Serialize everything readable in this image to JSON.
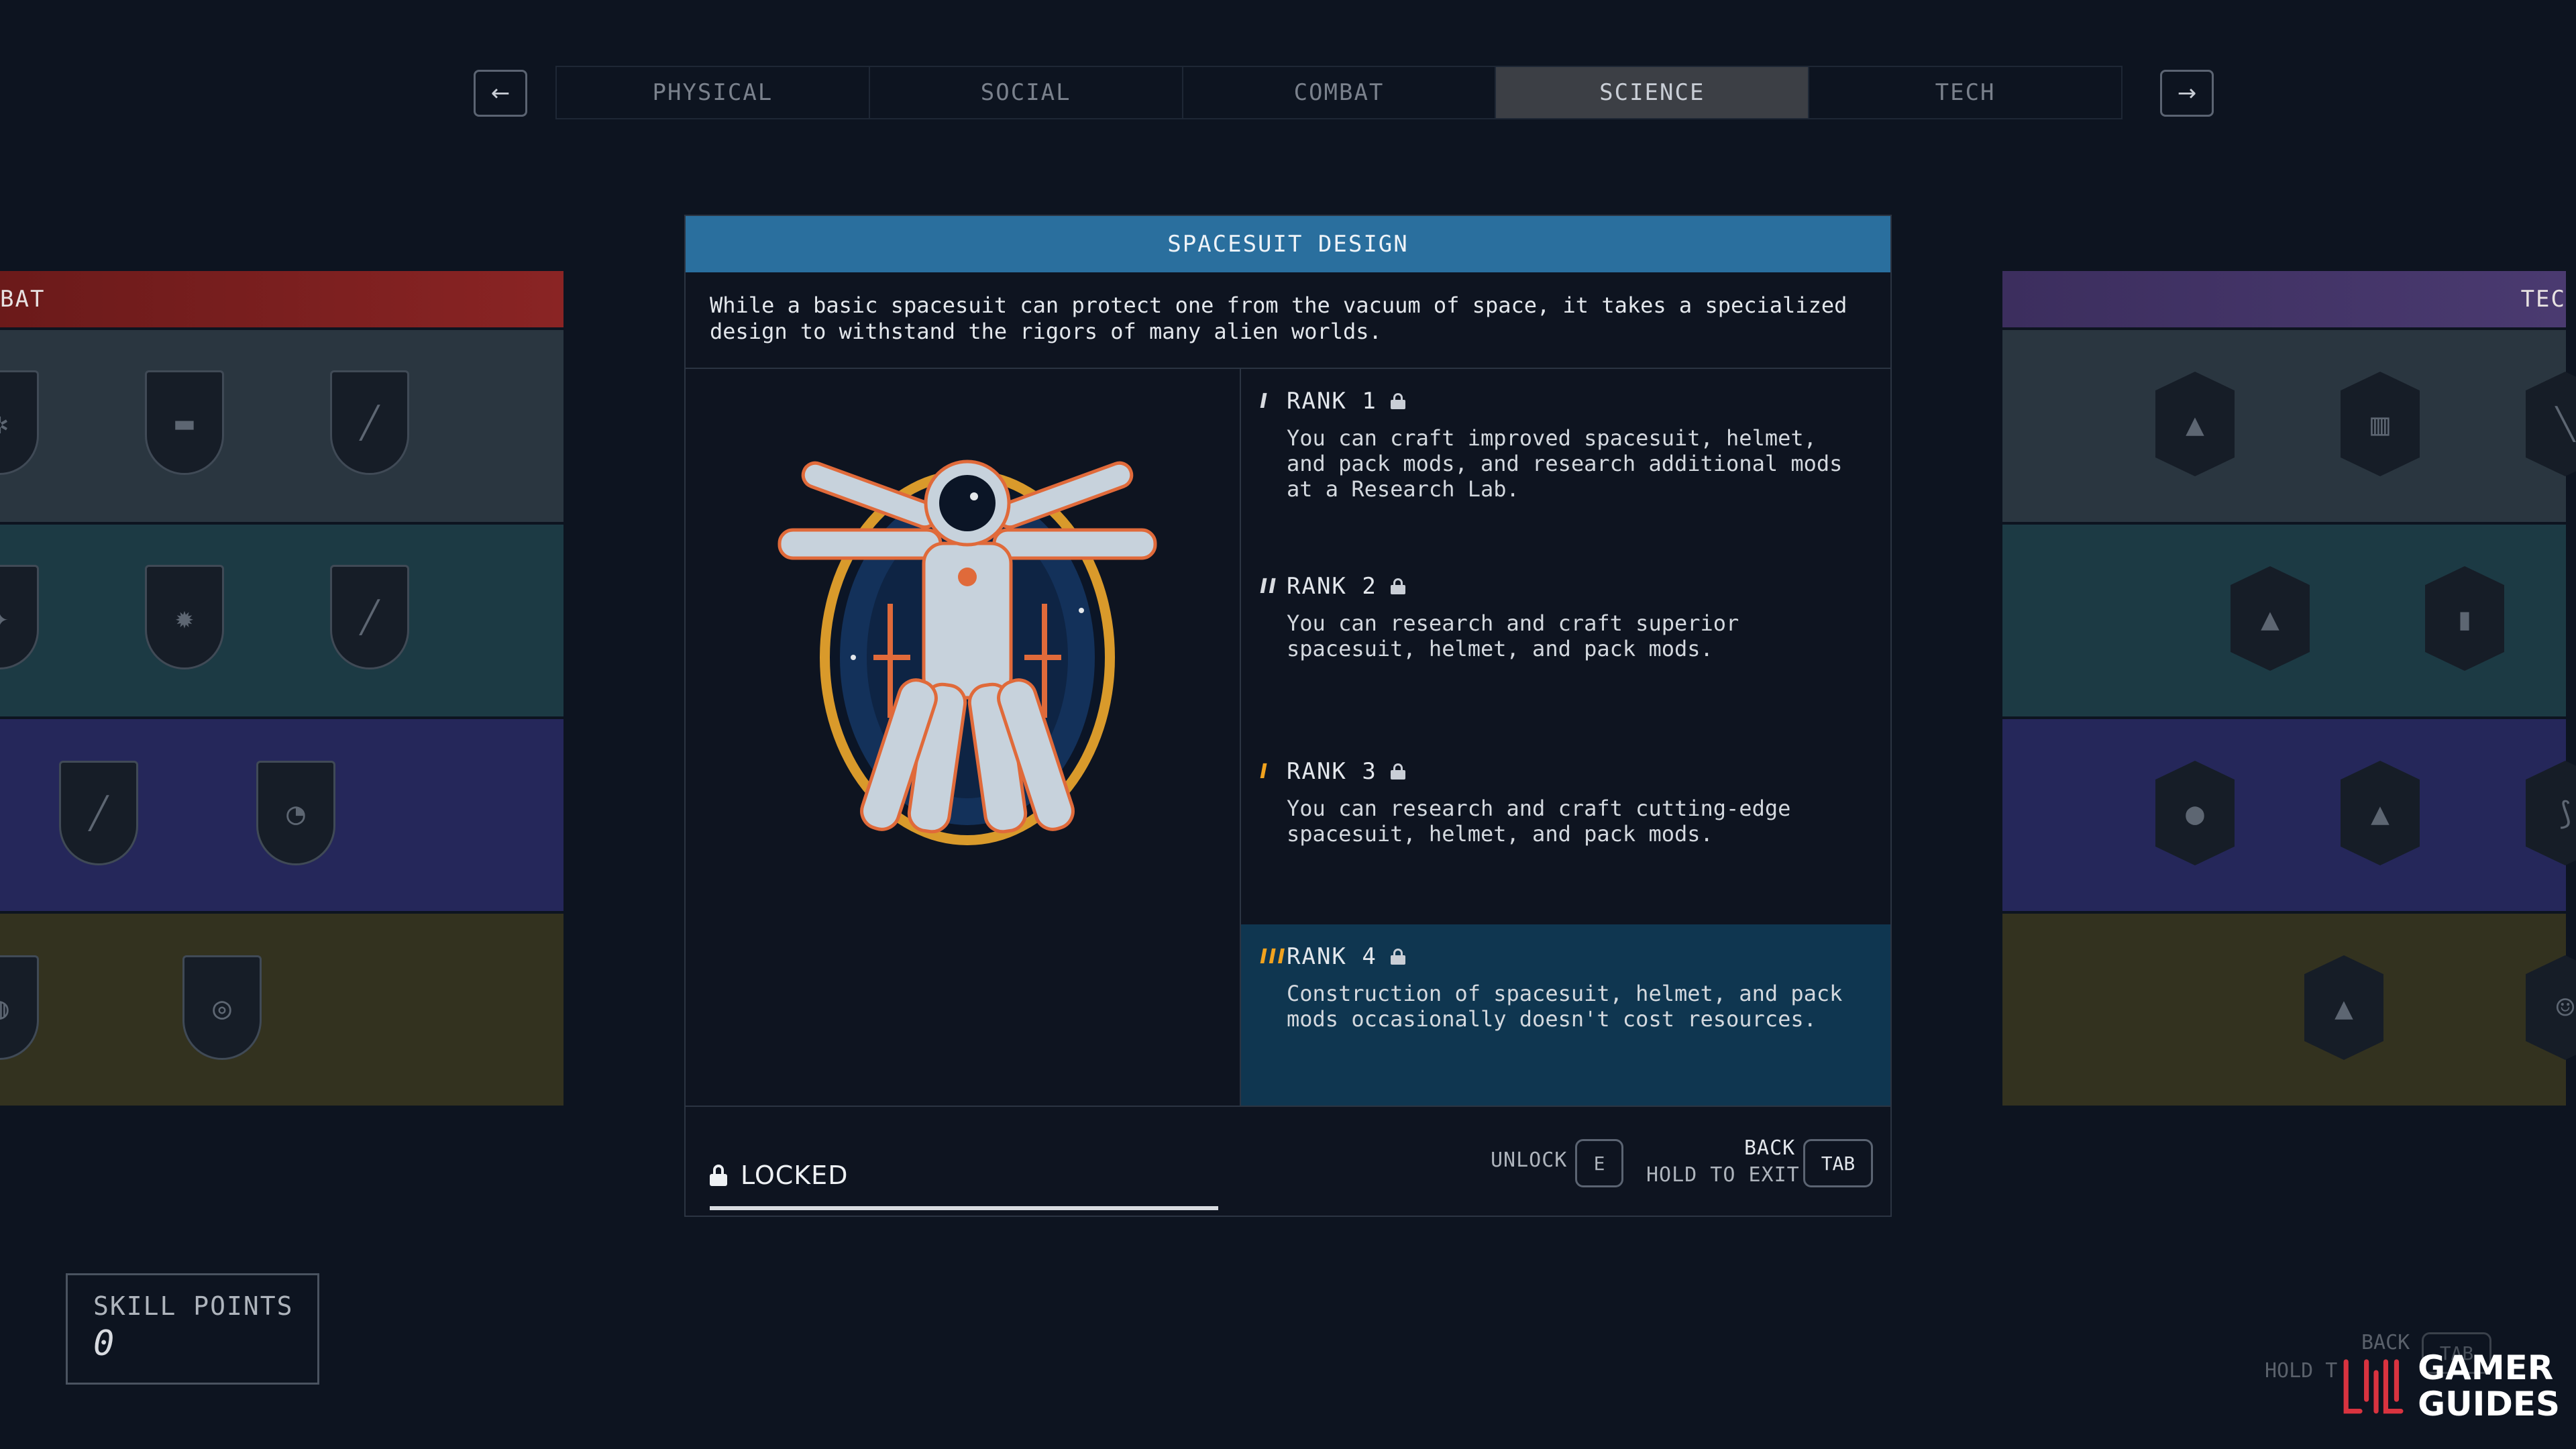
{
  "nav": {
    "prev_icon": "arrow-left-icon",
    "next_icon": "arrow-right-icon",
    "prev_glyph": "←",
    "next_glyph": "→",
    "tabs": [
      {
        "label": "PHYSICAL",
        "active": false
      },
      {
        "label": "SOCIAL",
        "active": false
      },
      {
        "label": "COMBAT",
        "active": false
      },
      {
        "label": "SCIENCE",
        "active": true
      },
      {
        "label": "TECH",
        "active": false
      }
    ]
  },
  "left_tree": {
    "header": "BAT"
  },
  "right_tree": {
    "header": "TEC"
  },
  "skill": {
    "title": "SPACESUIT DESIGN",
    "description": "While a basic spacesuit can protect one from the vacuum of space, it takes a specialized design to withstand the rigors of many alien worlds.",
    "status": "LOCKED",
    "ranks": [
      {
        "label": "RANK 1",
        "marks": "I",
        "text": "You can craft improved spacesuit, helmet, and pack mods, and research additional mods at a Research Lab."
      },
      {
        "label": "RANK 2",
        "marks": "II",
        "text": "You can research and craft superior spacesuit, helmet, and pack mods."
      },
      {
        "label": "RANK 3",
        "marks": "I",
        "text": "You can research and craft cutting-edge spacesuit, helmet, and pack mods."
      },
      {
        "label": "RANK 4",
        "marks": "III",
        "text": "Construction of spacesuit, helmet, and pack mods occasionally doesn't cost resources."
      }
    ]
  },
  "footer": {
    "unlock_label": "UNLOCK",
    "unlock_key": "E",
    "back_label": "BACK",
    "hold_label": "HOLD TO EXIT",
    "back_key": "TAB"
  },
  "skill_points": {
    "label": "SKILL POINTS",
    "value": "0"
  },
  "ghost_hint": {
    "back": "BACK",
    "hold": "HOLD T",
    "key": "TAB"
  },
  "watermark": {
    "line1": "GAMER",
    "line2": "GUIDES"
  },
  "colors": {
    "accent": "#2a6f9e",
    "rank_highlight": "#0f3650",
    "rank_orange": "#f0a21e"
  }
}
